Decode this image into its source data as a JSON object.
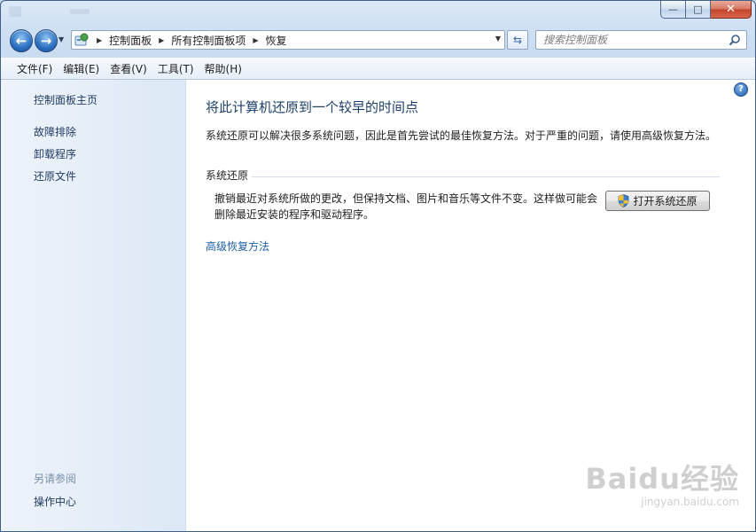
{
  "window": {
    "caption": {
      "minimize": "—",
      "maximize": "□",
      "close": "✕"
    }
  },
  "nav": {
    "back_icon": "arrow-left",
    "forward_icon": "arrow-right",
    "breadcrumbs": [
      "控制面板",
      "所有控制面板项",
      "恢复"
    ],
    "search_placeholder": "搜索控制面板"
  },
  "menu": [
    "文件(F)",
    "编辑(E)",
    "查看(V)",
    "工具(T)",
    "帮助(H)"
  ],
  "sidebar": {
    "home": "控制面板主页",
    "links": [
      "故障排除",
      "卸载程序",
      "还原文件"
    ],
    "see_also_title": "另请参阅",
    "see_also_links": [
      "操作中心"
    ]
  },
  "main": {
    "title": "将此计算机还原到一个较早的时间点",
    "description": "系统还原可以解决很多系统问题，因此是首先尝试的最佳恢复方法。对于严重的问题，请使用高级恢复方法。",
    "group_title": "系统还原",
    "group_text": "撤销最近对系统所做的更改，但保持文档、图片和音乐等文件不变。这样做可能会删除最近安装的程序和驱动程序。",
    "open_button": "打开系统还原",
    "advanced_link": "高级恢复方法"
  },
  "watermark": {
    "logo": "Baidu经验",
    "url": "jingyan.baidu.com"
  },
  "colors": {
    "link": "#1e5fa8",
    "title": "#1d3f6a",
    "sidebar_bg": "#dce8f6"
  }
}
